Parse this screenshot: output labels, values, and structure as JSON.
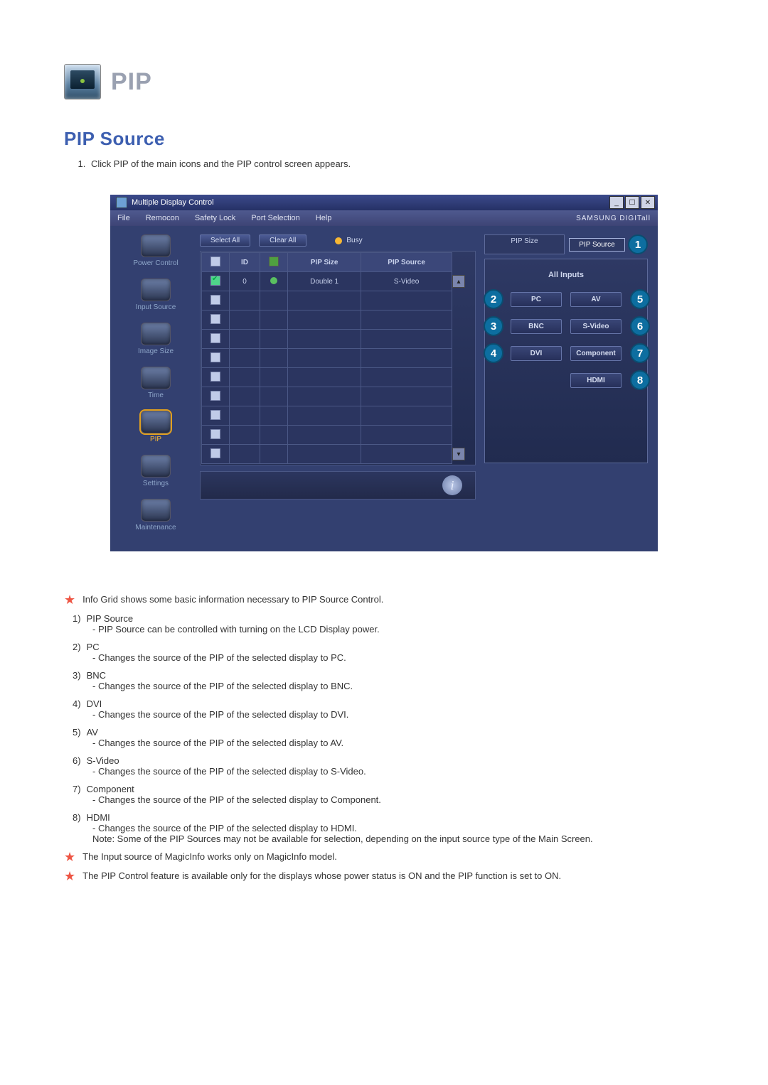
{
  "header": {
    "title": "PIP"
  },
  "section_title": "PIP Source",
  "intro": {
    "item_1": "Click PIP of the main icons and the PIP control screen appears."
  },
  "shot": {
    "title": "Multiple Display Control",
    "menus": [
      "File",
      "Remocon",
      "Safety Lock",
      "Port Selection",
      "Help"
    ],
    "brand": "SAMSUNG DIGITall",
    "sidebar": [
      "Power Control",
      "Input Source",
      "Image Size",
      "Time",
      "PIP",
      "Settings",
      "Maintenance"
    ],
    "toolbar": {
      "select_all": "Select All",
      "clear_all": "Clear All",
      "busy": "Busy"
    },
    "table": {
      "headers": [
        "",
        "ID",
        "",
        "PIP Size",
        "PIP Source"
      ],
      "row": {
        "id": "0",
        "size": "Double 1",
        "source": "S-Video"
      }
    },
    "panel": {
      "tabs": [
        "PIP Size",
        "PIP Source"
      ],
      "heading": "All Inputs",
      "left": [
        "PC",
        "BNC",
        "DVI"
      ],
      "right": [
        "AV",
        "S-Video",
        "Component",
        "HDMI"
      ],
      "callouts": {
        "tab": "1",
        "l1": "2",
        "l2": "3",
        "l3": "4",
        "r1": "5",
        "r2": "6",
        "r3": "7",
        "r4": "8"
      }
    }
  },
  "expl": {
    "star_top": "Info Grid shows some basic information necessary to PIP Source Control.",
    "items": [
      {
        "label": "PIP Source",
        "sub": "PIP Source can be controlled with turning on the LCD Display power."
      },
      {
        "label": "PC",
        "sub": "Changes the source of the PIP of the selected display to PC."
      },
      {
        "label": "BNC",
        "sub": "Changes the source of the PIP of the selected display to BNC."
      },
      {
        "label": "DVI",
        "sub": "Changes the source of the PIP of the selected display to DVI."
      },
      {
        "label": "AV",
        "sub": "Changes the source of the PIP of the selected display to AV."
      },
      {
        "label": "S-Video",
        "sub": "Changes the source of the PIP of the selected display to S-Video."
      },
      {
        "label": "Component",
        "sub": "Changes the source of the PIP of the selected display to Component."
      },
      {
        "label": "HDMI",
        "sub": "Changes the source of the PIP of the selected display to HDMI."
      }
    ],
    "note": "Note: Some of the PIP Sources may not be available for selection, depending on the input source type of the Main Screen.",
    "star_b1": "The Input source of MagicInfo works only on MagicInfo model.",
    "star_b2": "The PIP Control feature is available only for the displays whose power status is ON and the PIP function is set to ON."
  }
}
